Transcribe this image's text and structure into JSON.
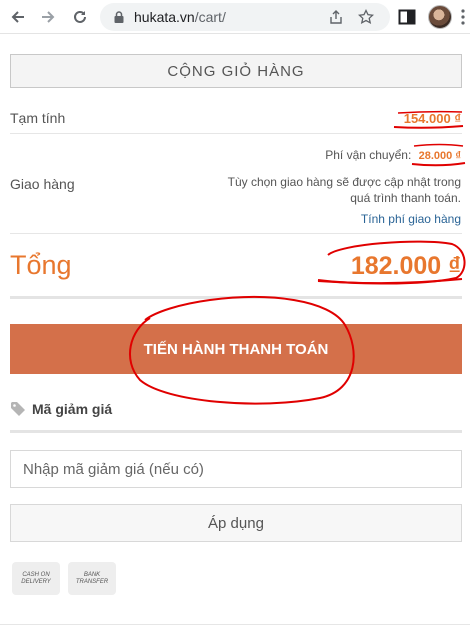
{
  "browser": {
    "url_host": "hukata.vn",
    "url_path": "/cart/"
  },
  "cart": {
    "header": "CỘNG GIỎ HÀNG",
    "subtotal_label": "Tạm tính",
    "subtotal_amount": "154.000 ₫",
    "shipping_label": "Giao hàng",
    "shipping_fee_label": "Phí vận chuyển:",
    "shipping_fee_amount": "28.000 ₫",
    "shipping_note_line1": "Tùy chọn giao hàng sẽ được cập nhật trong",
    "shipping_note_line2": "quá trình thanh toán.",
    "shipping_calc_link": "Tính phí giao hàng",
    "total_label": "Tổng",
    "total_amount": "182.000 ₫",
    "checkout_button": "TIẾN HÀNH THANH TOÁN"
  },
  "coupon": {
    "title": "Mã giảm giá",
    "input_placeholder": "Nhập mã giảm giá (nếu có)",
    "apply_button": "Áp dụng"
  },
  "payment_methods": [
    {
      "line1": "CASH ON",
      "line2": "DELIVERY"
    },
    {
      "line1": "BANK",
      "line2": "TRANSFER"
    }
  ],
  "colors": {
    "accent": "#e8772e",
    "checkout_button": "#d4704a",
    "annotation": "#e00000"
  },
  "icons": {
    "back": "arrow-left-icon",
    "forward": "arrow-right-icon",
    "reload": "reload-icon",
    "lock": "lock-icon",
    "share": "share-icon",
    "bookmark": "star-icon",
    "coupon": "tag-icon"
  }
}
